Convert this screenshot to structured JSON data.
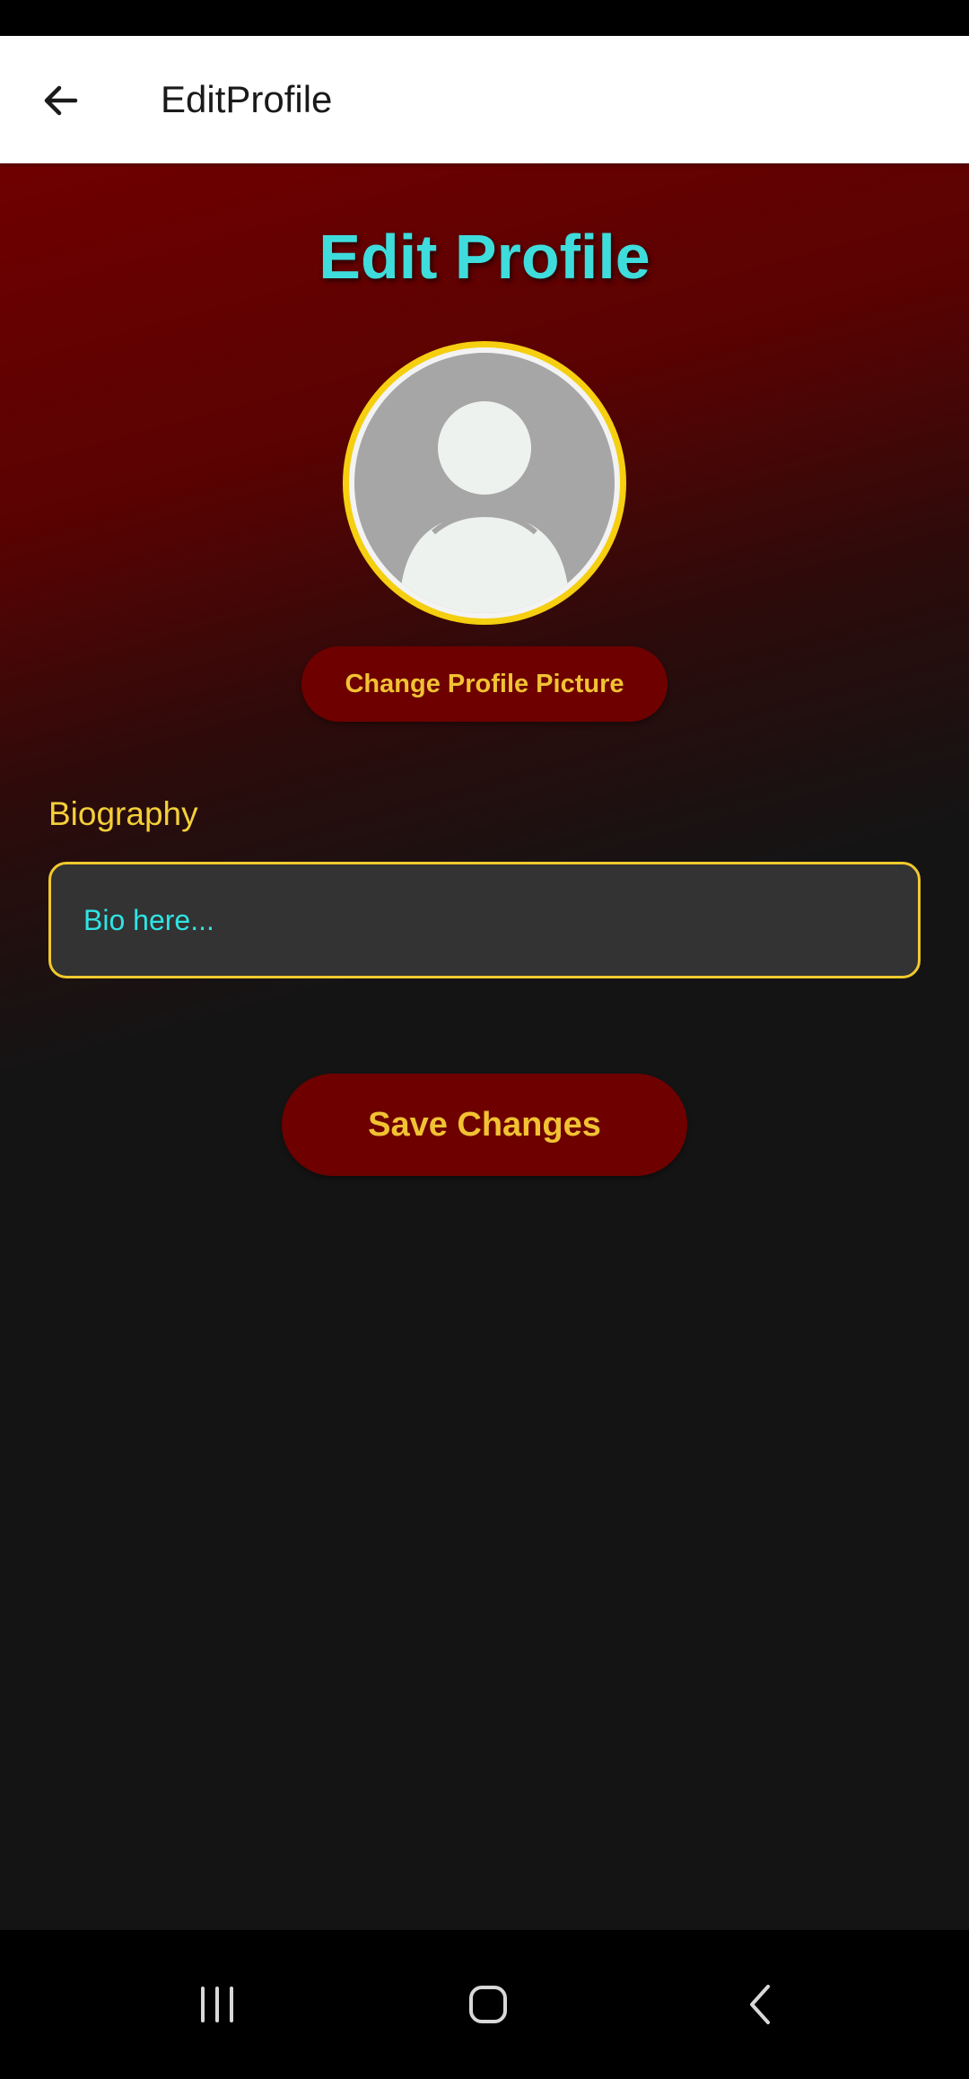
{
  "app_bar": {
    "title": "EditProfile",
    "back_icon": "arrow-left-icon"
  },
  "page": {
    "heading": "Edit Profile",
    "avatar_icon": "person-placeholder-icon",
    "change_picture_label": "Change Profile Picture",
    "bio_label": "Biography",
    "bio_placeholder": "Bio here...",
    "bio_value": "",
    "save_label": "Save Changes"
  },
  "nav_bar": {
    "recents_icon": "recents-icon",
    "home_icon": "home-icon",
    "back_icon": "nav-back-icon"
  },
  "colors": {
    "accent_cyan": "#3fdcdc",
    "accent_gold": "#f1c232",
    "button_bg": "#6e0000",
    "background": "#141414"
  }
}
